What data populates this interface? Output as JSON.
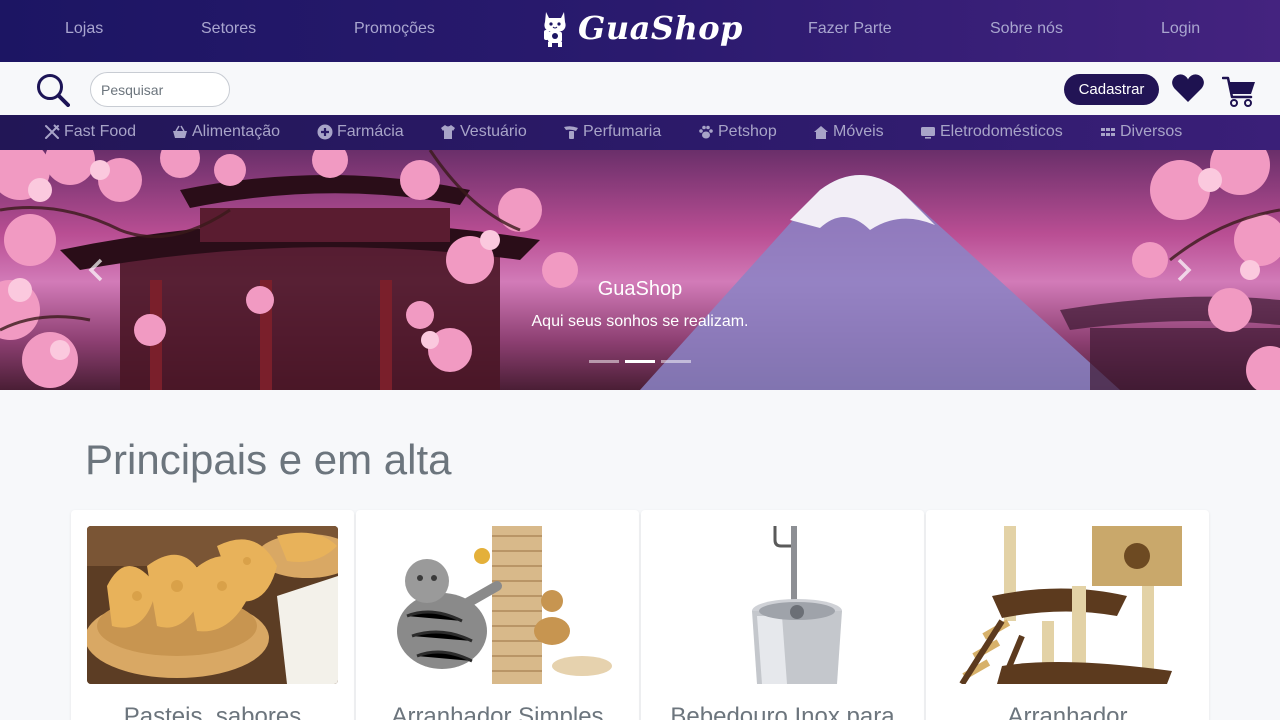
{
  "colors": {
    "nav_bg": "#1c1563",
    "nav_link": "#a9a6cf",
    "accent": "#221455",
    "section_title": "#6c757d"
  },
  "topnav": {
    "links_left": [
      "Lojas",
      "Setores",
      "Promoções"
    ],
    "links_right": [
      "Fazer Parte",
      "Sobre nós",
      "Login"
    ],
    "brand": "GuaShop",
    "brand_icon": "lucky-cat-icon"
  },
  "searchbar": {
    "search_icon": "search-icon",
    "placeholder": "Pesquisar",
    "value": "",
    "register_label": "Cadastrar",
    "favorites_icon": "heart-icon",
    "cart_icon": "cart-icon"
  },
  "categories": [
    {
      "label": "Fast Food",
      "icon": "utensils-icon"
    },
    {
      "label": "Alimentação",
      "icon": "basket-icon"
    },
    {
      "label": "Farmácia",
      "icon": "medical-plus-icon"
    },
    {
      "label": "Vestuário",
      "icon": "tshirt-icon"
    },
    {
      "label": "Perfumaria",
      "icon": "perfume-icon"
    },
    {
      "label": "Petshop",
      "icon": "paw-icon"
    },
    {
      "label": "Móveis",
      "icon": "house-icon"
    },
    {
      "label": "Eletrodomésticos",
      "icon": "tv-icon"
    },
    {
      "label": "Diversos",
      "icon": "grid-icon"
    }
  ],
  "carousel": {
    "title": "GuaShop",
    "subtitle": "Aqui seus sonhos se realizam.",
    "slide_count": 3,
    "active_slide": 2
  },
  "section": {
    "title": "Principais e em alta"
  },
  "products": [
    {
      "title": "Pasteis, sabores",
      "image": "pastries-in-bowl"
    },
    {
      "title": "Arranhador Simples",
      "image": "cat-scratching-post"
    },
    {
      "title": "Bebedouro Inox para",
      "image": "stainless-water-fountain"
    },
    {
      "title": "Arranhador",
      "image": "cat-tree"
    }
  ]
}
